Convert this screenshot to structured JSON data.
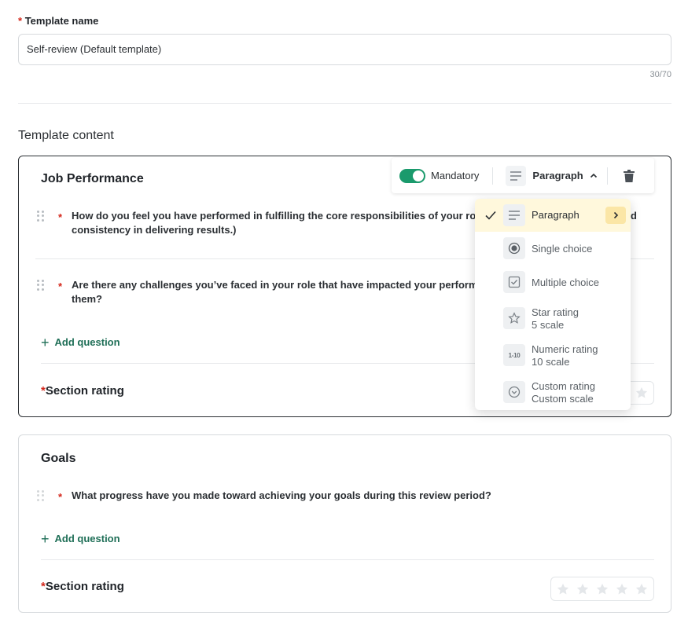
{
  "template_name": {
    "required_mark": "*",
    "label": "Template name",
    "value": "Self-review (Default template)",
    "counter": "30/70"
  },
  "content_title": "Template content",
  "sections": [
    {
      "title": "Job Performance",
      "questions": [
        {
          "required_mark": "*",
          "line1": "How do you feel you have performed in fulfilling the core responsibilities of your role?",
          "line1_tail": "d",
          "line2": "consistency in delivering results.)"
        },
        {
          "required_mark": "*",
          "line1": "Are there any challenges you’ve faced in your role that have impacted your performan",
          "line2": "them?"
        }
      ],
      "add_question": "Add question",
      "rating_required_mark": "*",
      "rating_label": "Section rating"
    },
    {
      "title": "Goals",
      "questions": [
        {
          "required_mark": "*",
          "line1": "What progress have you made toward achieving your goals during this review period?"
        }
      ],
      "add_question": "Add question",
      "rating_required_mark": "*",
      "rating_label": "Section rating",
      "rating_stars": 5
    }
  ],
  "toolbar": {
    "mandatory_label": "Mandatory",
    "mandatory_on": true,
    "type_label": "Paragraph",
    "icons": [
      "paragraph-icon",
      "chevron-up-icon",
      "trash-icon"
    ]
  },
  "type_menu": {
    "items": [
      {
        "label": "Paragraph",
        "icon": "paragraph-icon",
        "selected": true
      },
      {
        "label": "Single choice",
        "icon": "radio-icon"
      },
      {
        "label": "Multiple choice",
        "icon": "checkbox-icon"
      },
      {
        "label": "Star rating",
        "sub": "5 scale",
        "icon": "star-icon"
      },
      {
        "label": "Numeric rating",
        "sub": "10 scale",
        "icon": "numeric-icon",
        "glyph": "1-10"
      },
      {
        "label": "Custom rating",
        "sub": "Custom scale",
        "icon": "chevron-circle-icon"
      }
    ]
  },
  "colors": {
    "accent_green": "#1a9a6c",
    "link_green": "#1f6f57",
    "required_red": "#d4281c",
    "selected_bg": "#fff8dc",
    "arrow_bg": "#fbe6a6"
  }
}
